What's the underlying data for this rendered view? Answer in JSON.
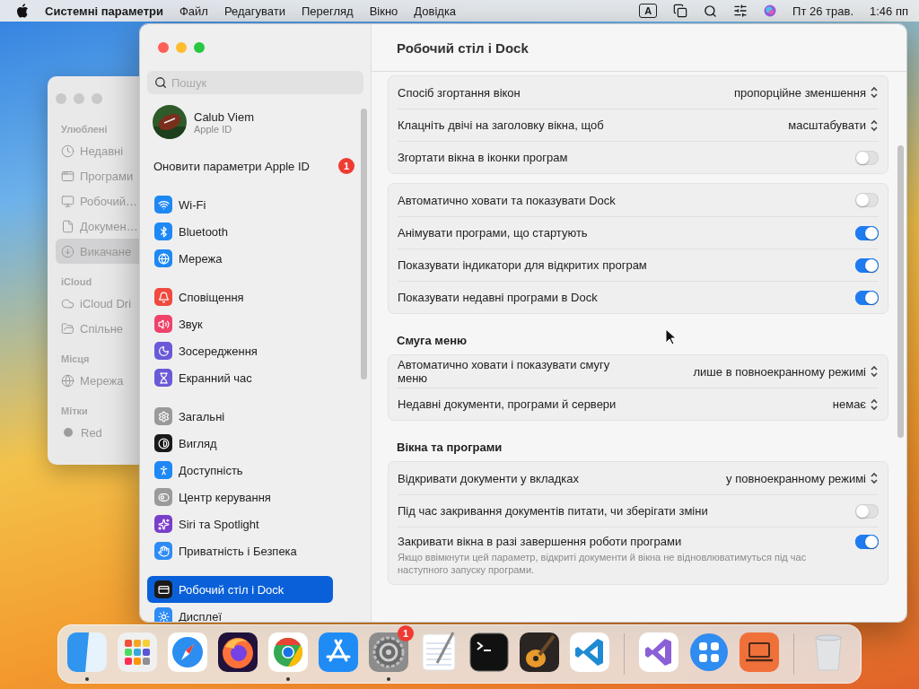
{
  "menu_bar": {
    "app_name": "Системні параметри",
    "menus": [
      "Файл",
      "Редагувати",
      "Перегляд",
      "Вікно",
      "Довідка"
    ],
    "input_source": "A",
    "date": "Пт 26 трав.",
    "time": "1:46 пп"
  },
  "finder": {
    "sections": [
      {
        "title": "Улюблені",
        "items": [
          {
            "label": "Недавні",
            "kind": "clock",
            "selected": false
          },
          {
            "label": "Програми",
            "kind": "apps",
            "selected": false
          },
          {
            "label": "Робочий…",
            "kind": "desktop",
            "selected": false
          },
          {
            "label": "Докумен…",
            "kind": "document",
            "selected": false
          },
          {
            "label": "Викачане",
            "kind": "download",
            "selected": true
          }
        ]
      },
      {
        "title": "iCloud",
        "items": [
          {
            "label": "iCloud Dri",
            "kind": "cloud",
            "selected": false
          },
          {
            "label": "Спільне",
            "kind": "shared",
            "selected": false
          }
        ]
      },
      {
        "title": "Місця",
        "items": [
          {
            "label": "Мережа",
            "kind": "network",
            "selected": false
          }
        ]
      },
      {
        "title": "Мітки",
        "items": [
          {
            "label": "Red",
            "kind": "tag",
            "selected": false
          }
        ]
      }
    ]
  },
  "settings": {
    "search": {
      "placeholder": "Пошук"
    },
    "account": {
      "name": "Calub Viem",
      "subtitle": "Apple ID"
    },
    "notice": {
      "label": "Оновити параметри Apple ID",
      "badge": "1"
    },
    "groups": [
      [
        {
          "label": "Wi-Fi",
          "kind": "wifi",
          "color": "#1e88f5",
          "selected": false
        },
        {
          "label": "Bluetooth",
          "kind": "bluetooth",
          "color": "#1e88f5",
          "selected": false
        },
        {
          "label": "Мережа",
          "kind": "network",
          "color": "#1e88f5",
          "selected": false
        }
      ],
      [
        {
          "label": "Сповіщення",
          "kind": "bell",
          "color": "#f04a3e",
          "selected": false
        },
        {
          "label": "Звук",
          "kind": "sound",
          "color": "#f0426a",
          "selected": false
        },
        {
          "label": "Зосередження",
          "kind": "moon",
          "color": "#6a5ad8",
          "selected": false
        },
        {
          "label": "Екранний час",
          "kind": "hourglass",
          "color": "#6a5ad8",
          "selected": false
        }
      ],
      [
        {
          "label": "Загальні",
          "kind": "gear",
          "color": "#9a9a9a",
          "selected": false
        },
        {
          "label": "Вигляд",
          "kind": "contrast",
          "color": "#1a1a1a",
          "selected": false
        },
        {
          "label": "Доступність",
          "kind": "accessibility",
          "color": "#1e88f5",
          "selected": false
        },
        {
          "label": "Центр керування",
          "kind": "toggles",
          "color": "#9a9a9a",
          "selected": false
        },
        {
          "label": "Siri та Spotlight",
          "kind": "siri",
          "color": "#7a3fc9",
          "selected": false
        },
        {
          "label": "Приватність і Безпека",
          "kind": "hand",
          "color": "#2f8cf5",
          "selected": false
        }
      ],
      [
        {
          "label": "Робочий стіл і Dock",
          "kind": "dock",
          "color": "#1a1a1a",
          "selected": true
        },
        {
          "label": "Дисплеї",
          "kind": "sun",
          "color": "#2f8cf5",
          "selected": false
        }
      ]
    ],
    "title": "Робочий стіл і Dock",
    "sections": [
      {
        "rows": [
          {
            "kind": "select",
            "label": "Спосіб згортання вікон",
            "value": "пропорційне зменшення"
          },
          {
            "kind": "select",
            "label": "Клацніть двічі на заголовку вікна, щоб",
            "value": "масштабувати"
          },
          {
            "kind": "toggle",
            "label": "Згортати вікна в іконки програм",
            "on": false
          }
        ]
      },
      {
        "rows": [
          {
            "kind": "toggle",
            "label": "Автоматично ховати та показувати Dock",
            "on": false
          },
          {
            "kind": "toggle",
            "label": "Анімувати програми, що стартують",
            "on": true
          },
          {
            "kind": "toggle",
            "label": "Показувати індикатори для відкритих програм",
            "on": true
          },
          {
            "kind": "toggle",
            "label": "Показувати недавні програми в Dock",
            "on": true
          }
        ]
      },
      {
        "heading": "Смуга меню",
        "rows": [
          {
            "kind": "select",
            "label": "Автоматично ховати і показувати смугу меню",
            "value": "лише в повноекранному режимі"
          },
          {
            "kind": "select",
            "label": "Недавні документи, програми й сервери",
            "value": "немає"
          }
        ]
      },
      {
        "heading": "Вікна та програми",
        "rows": [
          {
            "kind": "select",
            "label": "Відкривати документи у вкладках",
            "value": "у повноекранному режимі"
          },
          {
            "kind": "toggle",
            "label": "Під час закривання документів питати, чи зберігати зміни",
            "on": false
          },
          {
            "kind": "toggle",
            "label": "Закривати вікна в разі завершення роботи програми",
            "on": true,
            "note": "Якщо ввімкнути цей параметр, відкриті документи й вікна не відновлюватимуться під час наступного запуску програми."
          }
        ]
      }
    ]
  },
  "dock": {
    "apps": [
      {
        "kind": "finder",
        "running": true
      },
      {
        "kind": "launchpad",
        "running": false
      },
      {
        "kind": "safari",
        "running": false
      },
      {
        "kind": "firefox",
        "running": false
      },
      {
        "kind": "chrome",
        "running": true
      },
      {
        "kind": "appstore",
        "running": false
      },
      {
        "kind": "settings",
        "running": true,
        "badge": "1"
      },
      {
        "kind": "textedit",
        "running": false
      },
      {
        "kind": "terminal",
        "running": false
      },
      {
        "kind": "garageband",
        "running": false
      },
      {
        "kind": "vscode",
        "running": false
      },
      {
        "kind": "separator"
      },
      {
        "kind": "vstudio",
        "running": false
      },
      {
        "kind": "squares",
        "running": false
      },
      {
        "kind": "laptop",
        "running": false
      },
      {
        "kind": "separator"
      },
      {
        "kind": "trash",
        "running": false
      }
    ]
  }
}
